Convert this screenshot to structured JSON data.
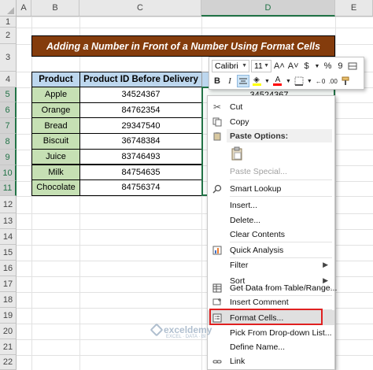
{
  "column_headers": [
    "A",
    "B",
    "C",
    "D",
    "E"
  ],
  "row_headers": [
    "1",
    "2",
    "3",
    "4",
    "5",
    "6",
    "7",
    "8",
    "9",
    "10",
    "11",
    "12",
    "13",
    "14",
    "15",
    "16",
    "17",
    "18",
    "19",
    "20",
    "21",
    "22"
  ],
  "title": "Adding a Number in Front of a Number Using Format Cells",
  "table": {
    "headers": [
      "Product",
      "Product ID Before Delivery"
    ],
    "rows": [
      {
        "product": "Apple",
        "id": "34524367"
      },
      {
        "product": "Orange",
        "id": "84762354"
      },
      {
        "product": "Bread",
        "id": "29347540"
      },
      {
        "product": "Biscuit",
        "id": "36748384"
      },
      {
        "product": "Juice",
        "id": "83746493"
      },
      {
        "product": "Milk",
        "id": "84754635"
      },
      {
        "product": "Chocolate",
        "id": "84756374"
      }
    ],
    "d5_value": "34524367"
  },
  "mini_toolbar": {
    "font_name": "Calibri",
    "font_size": "11",
    "grow_font": "A˄",
    "shrink_font": "A˅",
    "currency": "$",
    "percent": "%",
    "comma": "9",
    "bold": "B",
    "italic": "I",
    "font_color_letter": "A"
  },
  "context_menu": {
    "cut": "Cut",
    "copy": "Copy",
    "paste_options_header": "Paste Options:",
    "paste_special": "Paste Special...",
    "smart_lookup": "Smart Lookup",
    "insert": "Insert...",
    "delete": "Delete...",
    "clear_contents": "Clear Contents",
    "quick_analysis": "Quick Analysis",
    "filter": "Filter",
    "sort": "Sort",
    "get_data": "Get Data from Table/Range...",
    "insert_comment": "Insert Comment",
    "format_cells": "Format Cells...",
    "pick_from_list": "Pick From Drop-down List...",
    "define_name": "Define Name...",
    "link": "Link"
  },
  "watermark": {
    "name": "exceldemy",
    "tagline": "EXCEL · DATA · BI"
  },
  "colors": {
    "title_bg": "#843c0c",
    "header_bg": "#bdd7ee",
    "product_bg": "#c6e0b4",
    "selection": "#217346",
    "highlight_box": "#e02020",
    "fill_color": "#ffff00",
    "font_color": "#ff0000"
  }
}
